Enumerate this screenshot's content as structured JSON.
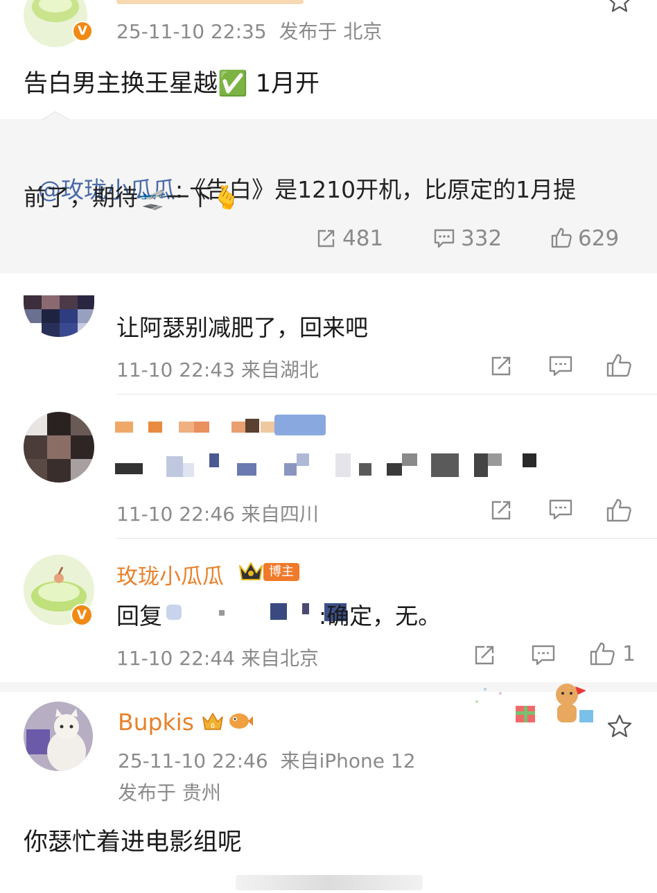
{
  "post1": {
    "meta": "25-11-10 22:35  发布于 北京",
    "text": "告白男主换王星越✅ 1月开",
    "repost": {
      "mention": "@玫珑小瓜瓜",
      "text_line1": ":《告白》是1210开机，比原定的1月提",
      "text_line2": "前了，期待🛫一下🫰",
      "stats": {
        "reposts": "481",
        "comments": "332",
        "likes": "629"
      }
    }
  },
  "comments": [
    {
      "text": "让阿瑟别减肥了，回来吧",
      "meta": "11-10 22:43 来自湖北"
    },
    {
      "meta": "11-10 22:46 来自四川"
    },
    {
      "name": "玫珑小瓜瓜",
      "badge": "博主",
      "reply_prefix": "回复",
      "reply_suffix": ":确定，无。",
      "meta": "11-10 22:44 来自北京",
      "like_count": "1"
    }
  ],
  "post2": {
    "username": "Bupkis",
    "meta": "25-11-10 22:46  来自iPhone 12",
    "location": "发布于 贵州",
    "text": "你瑟忙着进电影组呢"
  },
  "colors": {
    "orange_name": "#e8812b",
    "meta_gray": "#8a8a8a",
    "repost_bg": "#f5f5f5",
    "link_blue": "#4a6ba8"
  },
  "icons": [
    "verified-v-icon",
    "star-icon",
    "repost-icon",
    "comment-icon",
    "like-icon",
    "crown-icon"
  ]
}
